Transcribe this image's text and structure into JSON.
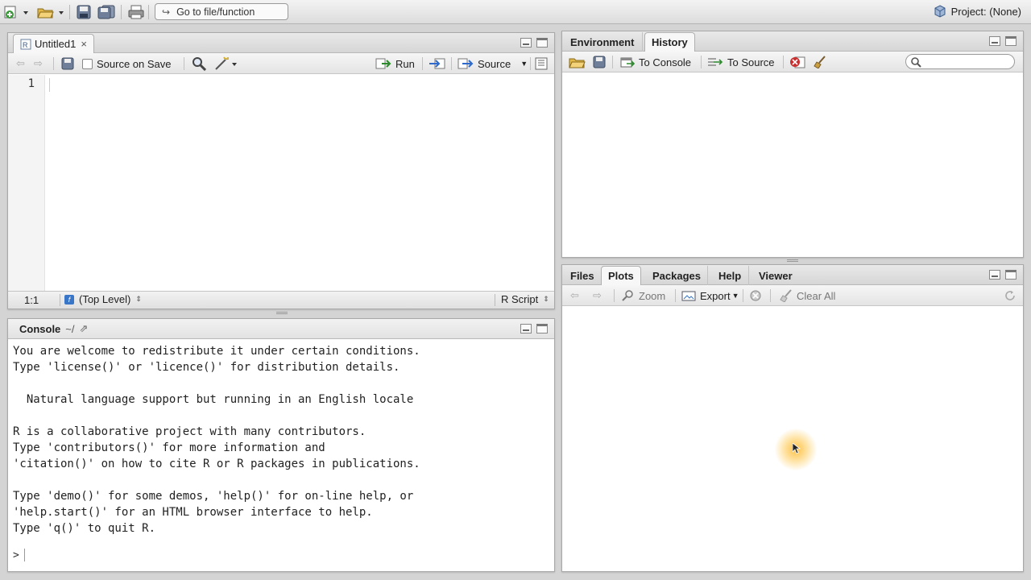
{
  "main_toolbar": {
    "goto_placeholder": "Go to file/function",
    "project_label": "Project: (None)"
  },
  "source_pane": {
    "tab_label": "Untitled1",
    "close_glyph": "×",
    "source_on_save_label": "Source on Save",
    "run_label": "Run",
    "source_label": "Source",
    "line_number": "1",
    "status_position": "1:1",
    "status_scope": "(Top Level)",
    "status_filetype": "R Script"
  },
  "console_pane": {
    "title": "Console",
    "path": "~/",
    "lines": [
      "You are welcome to redistribute it under certain conditions.",
      "Type 'license()' or 'licence()' for distribution details.",
      "",
      "  Natural language support but running in an English locale",
      "",
      "R is a collaborative project with many contributors.",
      "Type 'contributors()' for more information and",
      "'citation()' on how to cite R or R packages in publications.",
      "",
      "Type 'demo()' for some demos, 'help()' for on-line help, or",
      "'help.start()' for an HTML browser interface to help.",
      "Type 'q()' to quit R."
    ],
    "prompt": ">"
  },
  "env_pane": {
    "tabs": [
      "Environment",
      "History"
    ],
    "active_tab": "History",
    "to_console_label": "To Console",
    "to_source_label": "To Source",
    "search_placeholder": ""
  },
  "files_pane": {
    "tabs": [
      "Files",
      "Plots",
      "Packages",
      "Help",
      "Viewer"
    ],
    "active_tab": "Plots",
    "zoom_label": "Zoom",
    "export_label": "Export",
    "clear_all_label": "Clear All"
  },
  "colors": {
    "accent": "#3a76c7",
    "highlight": "#ffbe3c"
  }
}
